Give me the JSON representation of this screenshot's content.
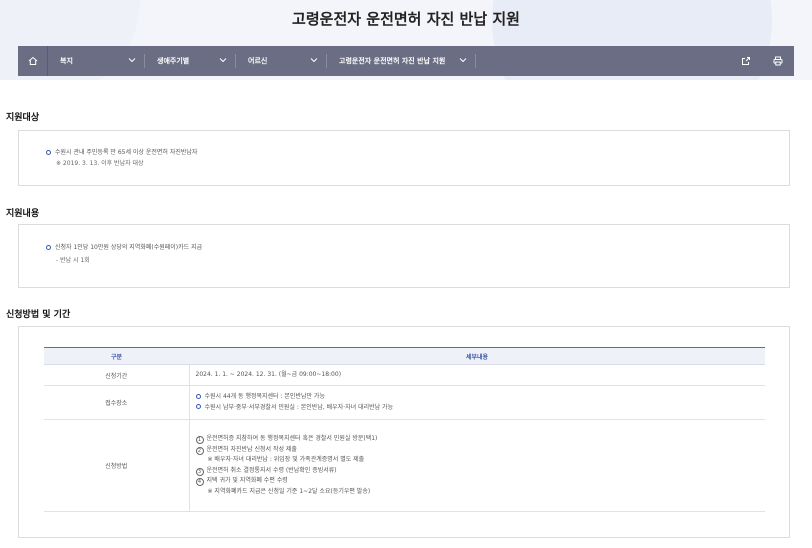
{
  "page_title": "고령운전자 운전면허 자진 반납 지원",
  "nav": {
    "items": [
      {
        "label": "복지"
      },
      {
        "label": "생애주기별"
      },
      {
        "label": "어르신"
      },
      {
        "label": "고령운전자 운전면허 자진 반납 지원"
      }
    ]
  },
  "section1": {
    "title": "지원대상",
    "line1": "수원시 관내 주민등록 만 65세 이상 운전면허 자진반납자",
    "note": "※ 2019. 3. 13. 이후 반납자 대상"
  },
  "section2": {
    "title": "지원내용",
    "line1": "신청자 1인당 10만원 상당의 지역화폐(수원페이)카드 지급",
    "sub": "- 반납 시 1회"
  },
  "section3": {
    "title": "신청방법 및 기간",
    "table": {
      "headers": [
        "구분",
        "세부내용"
      ],
      "rows": [
        {
          "label": "신청기간",
          "lines": [
            "2024. 1. 1. ~ 2024. 12. 31. (월~금 09:00~18:00)"
          ]
        },
        {
          "label": "접수장소",
          "lines": [
            "수원시 44개 동 행정복지센터 : 본인반납만 가능",
            "수원시 남부·중부·서부경찰서 민원실 : 본인반납, 배우자·자녀 대리반납 가능"
          ]
        },
        {
          "label": "신청방법",
          "steps": [
            {
              "num": "1",
              "text": "운전면허증 지참하여 동 행정복지센터 혹은 경찰서 민원실 방문(택1)"
            },
            {
              "num": "2",
              "text": "운전면허 자진반납 신청서 작성 제출"
            },
            {
              "num": "",
              "text": "※ 배우자·자녀 대리반납 : 위임장 및 가족관계증명서 별도 제출"
            },
            {
              "num": "3",
              "text": "운전면허 취소 결정통지서 수령 (반납확인 증빙서류)"
            },
            {
              "num": "4",
              "text": "지택 귀가 및 지역화폐 수편 수령"
            },
            {
              "num": "",
              "text": "※ 지역화폐카드 지급은 신청일 기준 1~2달 소요(등기우편 발송)"
            }
          ]
        }
      ]
    }
  }
}
